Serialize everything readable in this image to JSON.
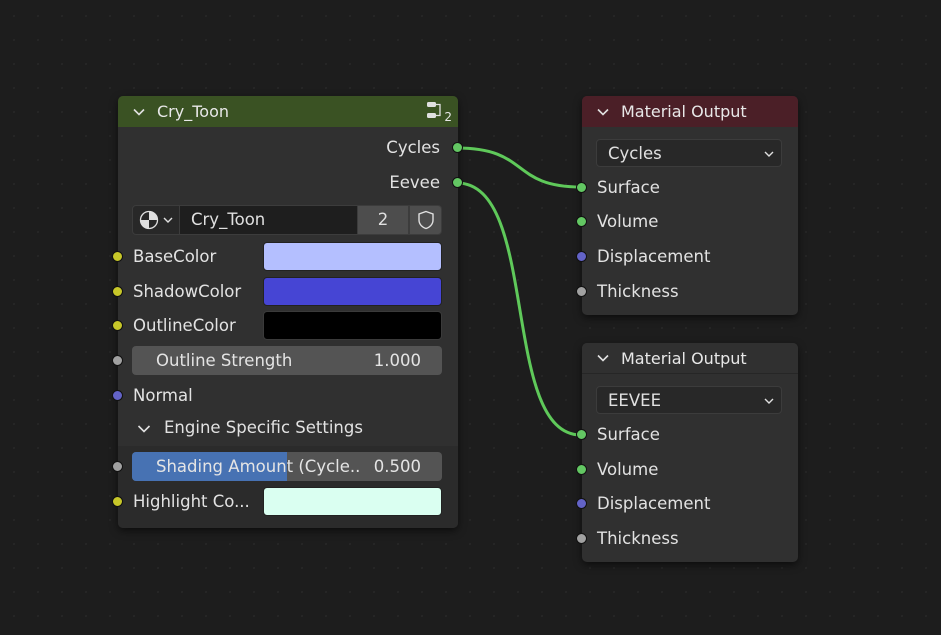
{
  "colors": {
    "background": "#1d1d1d",
    "node_body": "#303030",
    "group_header": "#3a5223",
    "output_header": "#4b1f27",
    "output_header_plain": "#303030",
    "link": "#5fc95a",
    "socket_shader": "#63c763",
    "socket_color": "#c7c729",
    "socket_float": "#a1a1a1",
    "socket_vector": "#6363c7",
    "slider_fill": "#4772b3"
  },
  "group_node": {
    "title": "Cry_Toon",
    "user_count": "2",
    "outputs": [
      "Cycles",
      "Eevee"
    ],
    "datablock": {
      "name": "Cry_Toon",
      "users": "2"
    },
    "inputs": {
      "base_color": {
        "label": "BaseColor",
        "color": "#b4bfff"
      },
      "shadow_color": {
        "label": "ShadowColor",
        "color": "#4645d4"
      },
      "outline_color": {
        "label": "OutlineColor",
        "color": "#000000"
      },
      "outline_strength": {
        "label": "Outline Strength",
        "value": "1.000"
      },
      "normal": {
        "label": "Normal"
      }
    },
    "panel": {
      "label": "Engine Specific Settings",
      "shading_amount": {
        "label": "Shading Amount (Cycle...",
        "value": "0.500",
        "fraction": 0.5
      },
      "highlight_color": {
        "label": "Highlight Co...",
        "color": "#dafff1"
      }
    }
  },
  "output_nodes": [
    {
      "title": "Material Output",
      "target": "Cycles",
      "inputs": [
        "Surface",
        "Volume",
        "Displacement",
        "Thickness"
      ]
    },
    {
      "title": "Material Output",
      "target": "EEVEE",
      "inputs": [
        "Surface",
        "Volume",
        "Displacement",
        "Thickness"
      ]
    }
  ],
  "icons": {
    "collapse": "chevron-down-icon",
    "node_tree": "node-tree-icon",
    "material_sphere": "material-sphere-icon",
    "fake_user": "shield-icon",
    "dropdown": "chevron-down-icon"
  }
}
